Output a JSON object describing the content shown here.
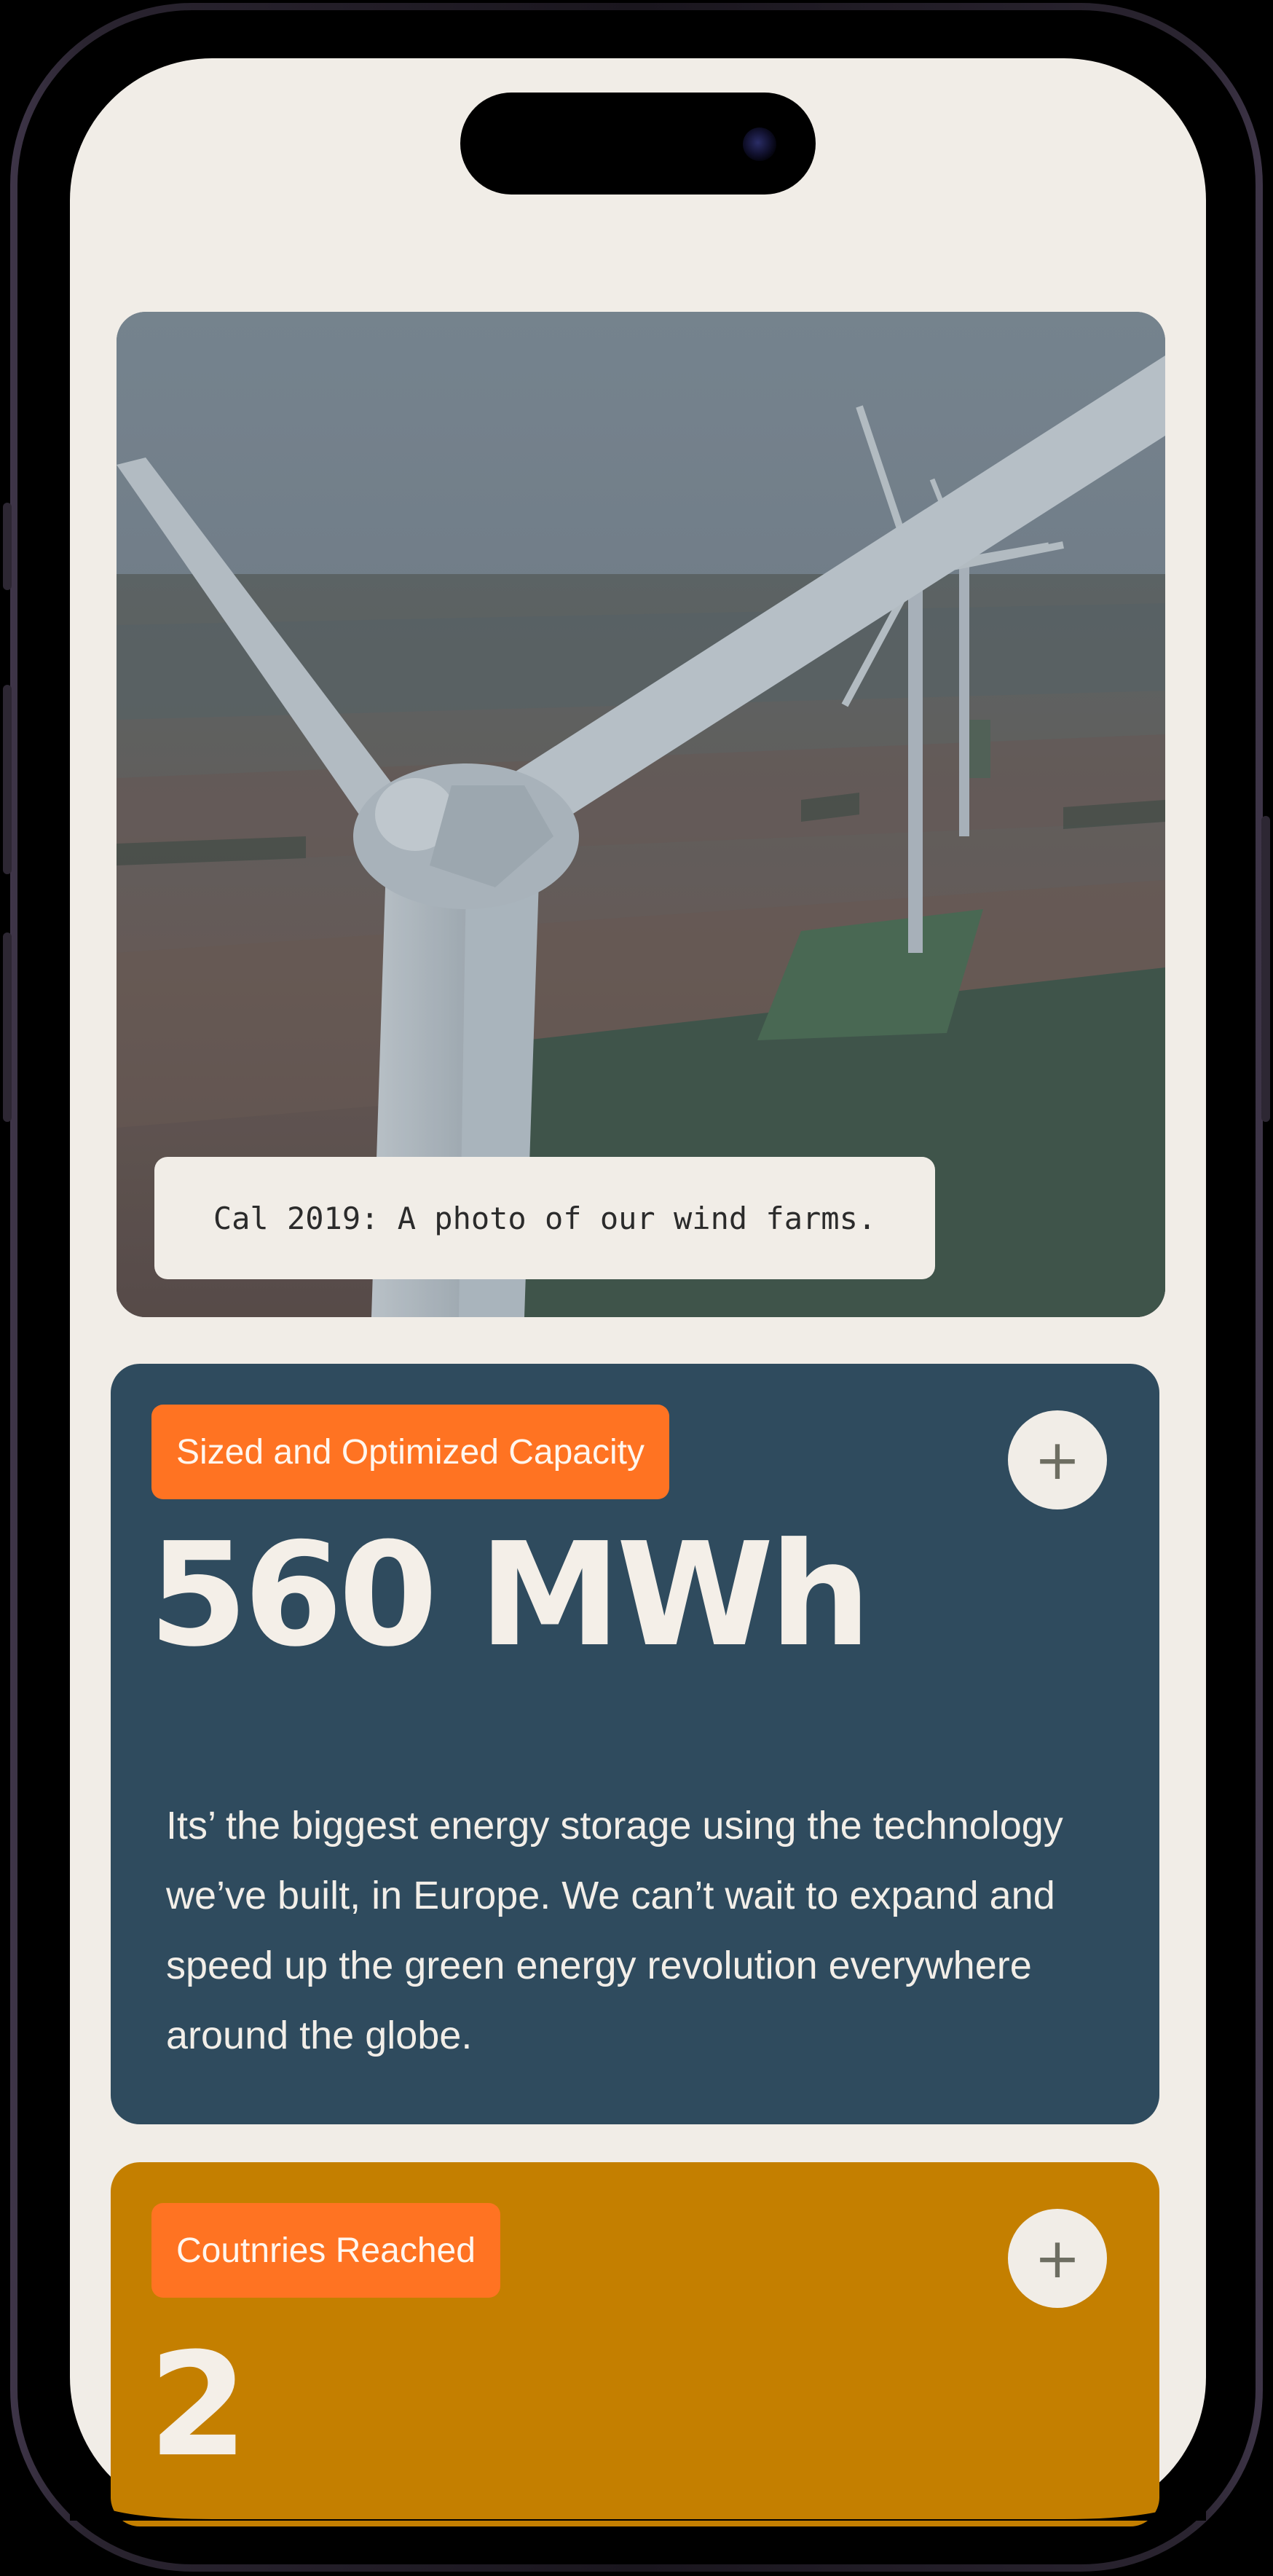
{
  "photo": {
    "caption": "Cal 2019: A photo of our wind farms.",
    "subject": "wind-turbines-aerial-photo"
  },
  "cards": [
    {
      "tag": "Sized and Optimized Capacity",
      "value": "560 MWh",
      "description": "Its’ the biggest energy storage using the technology we’ve built, in Europe. We can’t wait to expand and speed up the green energy revolution everywhere around the globe.",
      "expand_icon": "+",
      "background": "#2f4b5e"
    },
    {
      "tag": "Coutnries Reached",
      "value": "2",
      "expand_icon": "+",
      "background": "#c47f00"
    }
  ],
  "colors": {
    "screen_background": "#f1ede7",
    "tag_background": "#ff7322",
    "blue_card": "#2f4b5e",
    "gold_card": "#c47f00"
  }
}
